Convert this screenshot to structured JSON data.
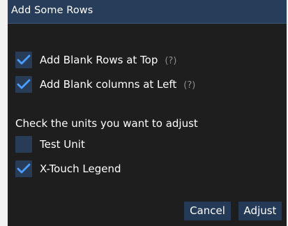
{
  "dialog": {
    "title": "Add Some Rows",
    "options": [
      {
        "label": "Add Blank Rows at Top",
        "help": "(?)",
        "checked": true
      },
      {
        "label": "Add Blank columns at Left",
        "help": "(?)",
        "checked": true
      }
    ],
    "units_prompt": "Check the units you want to adjust",
    "units": [
      {
        "label": "Test Unit",
        "checked": false
      },
      {
        "label": "X-Touch Legend",
        "checked": true
      }
    ],
    "buttons": {
      "cancel": "Cancel",
      "adjust": "Adjust"
    }
  },
  "colors": {
    "background": "#1e1e1e",
    "titlebar": "#273d5a",
    "checkbox": "#283c58",
    "check_mark": "#4a9eff",
    "button": "#253a56",
    "help_text": "#8c8c8c"
  },
  "icons": {
    "check": "checkmark-icon"
  }
}
